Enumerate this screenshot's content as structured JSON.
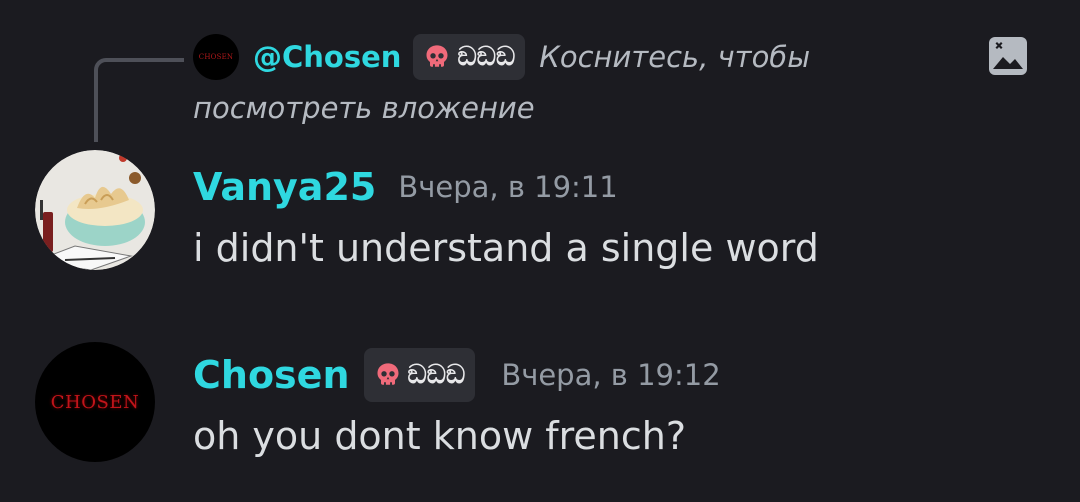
{
  "reply": {
    "avatar_text": "CHOSEN",
    "mention": "@Chosen",
    "tag_text": "ඞඞඞ",
    "hint_line1": "Коснитесь, чтобы",
    "hint_line2": "посмотреть вложение"
  },
  "messages": [
    {
      "author": "Vanya25",
      "timestamp": "Вчера, в 19:11",
      "text": "i didn't understand a single word"
    },
    {
      "author": "Chosen",
      "avatar_text": "CHOSEN",
      "tag_text": "ඞඞඞ",
      "timestamp": "Вчера, в 19:12",
      "text": "oh you dont know french?"
    }
  ],
  "colors": {
    "background": "#1b1b20",
    "username": "#2fd8e0",
    "tag_bg": "#2e2f35",
    "skull": "#f06a7a"
  },
  "icons": {
    "attachment": "image-attachment-icon",
    "tag": "skull-icon"
  }
}
